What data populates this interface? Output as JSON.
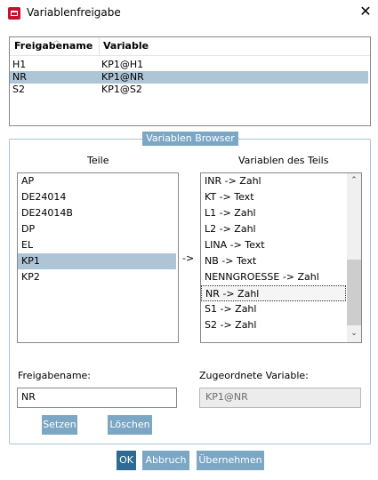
{
  "window": {
    "title": "Variablenfreigabe",
    "close_glyph": "✕",
    "icon": "app-logo-icon"
  },
  "table": {
    "headers": {
      "name": "Freigabename",
      "variable": "Variable"
    },
    "rows": [
      {
        "name": "H1",
        "variable": "KP1@H1"
      },
      {
        "name": "NR",
        "variable": "KP1@NR"
      },
      {
        "name": "S2",
        "variable": "KP1@S2"
      }
    ],
    "selected_index": 1
  },
  "browser": {
    "legend": "Variablen Browser",
    "teile_label": "Teile",
    "variablen_label": "Variablen des Teils",
    "arrow": "->",
    "teile": [
      "AP",
      "DE24014",
      "DE24014B",
      "DP",
      "EL",
      "KP1",
      "KP2"
    ],
    "teile_selected": 5,
    "variablen": [
      "INR -> Zahl",
      "KT -> Text",
      "L1 -> Zahl",
      "L2 -> Zahl",
      "LINA -> Text",
      "NB -> Text",
      "NENNGROESSE -> Zahl",
      "NR -> Zahl",
      "S1 -> Zahl",
      "S2 -> Zahl"
    ],
    "variablen_focused": 7,
    "freigabename_label": "Freigabename:",
    "freigabename_value": "NR",
    "zugeordnet_label": "Zugeordnete Variable:",
    "zugeordnet_value": "KP1@NR",
    "setzen_label": "Setzen",
    "loeschen_label": "Löschen"
  },
  "footer": {
    "ok_label": "OK",
    "abbruch_label": "Abbruch",
    "uebernehmen_label": "Übernehmen"
  },
  "colors": {
    "accent": "#7ba7c4",
    "accent_dark": "#2e6a94",
    "selection": "#aec5d7",
    "brand": "#c8102e"
  }
}
